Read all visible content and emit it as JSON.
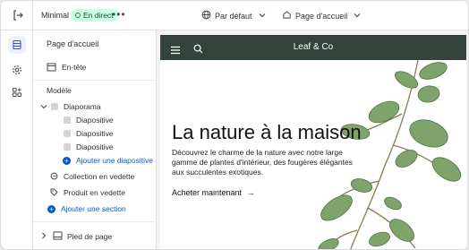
{
  "topbar": {
    "theme_name": "Minimal",
    "status_badge": "En direct",
    "more_label": "•••",
    "device_label": "Par défaut",
    "page_label": "Page d'accueil"
  },
  "sidebar": {
    "title": "Page d'accueil",
    "header_item": "En-tête",
    "template_title": "Modèle",
    "slideshow": "Diaporama",
    "slides": [
      "Diapositive",
      "Diapositive",
      "Diapositive"
    ],
    "add_slide": "Ajouter une diapositive",
    "featured_collection": "Collection en vedette",
    "featured_product": "Produit en vedette",
    "add_section": "Ajouter une section",
    "footer_item": "Pied de page"
  },
  "preview": {
    "brand": "Leaf & Co",
    "hero_title": "La nature à la maison",
    "hero_text": "Découvrez le charme de la nature avec notre large gamme de plantes d'intérieur, des fougères élégantes aux succulentes exotiques.",
    "cta_label": "Acheter maintenant",
    "cta_arrow": "→"
  },
  "colors": {
    "accent": "#005bd3",
    "live_badge_bg": "#cdfee1",
    "header_bg": "#33423a"
  },
  "icons": {
    "exit": "exit-icon",
    "globe": "globe-icon",
    "home": "home-icon",
    "sections": "sections-icon",
    "settings": "gear-icon",
    "apps": "apps-icon",
    "menu": "hamburger-icon",
    "search": "search-icon"
  }
}
